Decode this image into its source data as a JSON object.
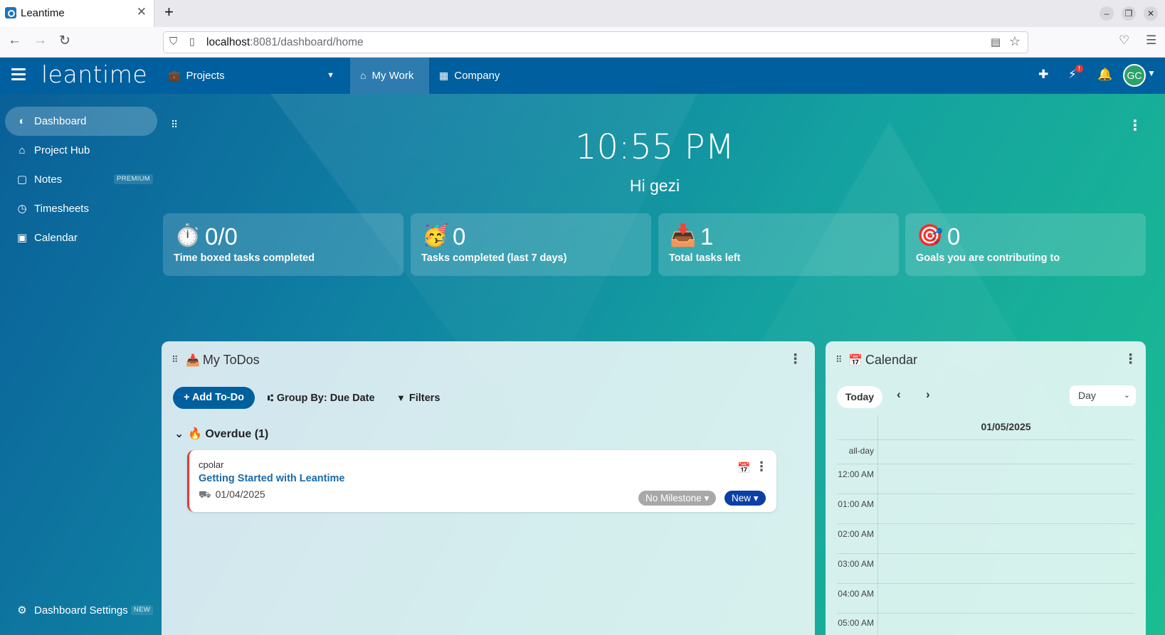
{
  "browser": {
    "tab_title": "Leantime",
    "url_host": "localhost",
    "url_rest": ":8081/dashboard/home"
  },
  "header": {
    "logo": "leantime",
    "projects_label": "Projects",
    "mywork_label": "My Work",
    "company_label": "Company",
    "notification_badge": "!",
    "avatar_initials": "GC"
  },
  "sidebar": {
    "items": [
      {
        "label": "Dashboard",
        "icon": "dashboard-icon"
      },
      {
        "label": "Project Hub",
        "icon": "house-icon"
      },
      {
        "label": "Notes",
        "icon": "note-icon",
        "tag": "PREMIUM"
      },
      {
        "label": "Timesheets",
        "icon": "clock-icon"
      },
      {
        "label": "Calendar",
        "icon": "calendar-icon"
      }
    ],
    "settings": {
      "label": "Dashboard Settings",
      "tag": "NEW"
    }
  },
  "welcome": {
    "time": "10:55 PM",
    "greeting": "Hi gezi"
  },
  "stats": [
    {
      "emoji": "⏱️",
      "value": "0/0",
      "caption": "Time boxed tasks completed"
    },
    {
      "emoji": "🥳",
      "value": "0",
      "caption": "Tasks completed (last 7 days)"
    },
    {
      "emoji": "📥",
      "value": "1",
      "caption": "Total tasks left"
    },
    {
      "emoji": "🎯",
      "value": "0",
      "caption": "Goals you are contributing to"
    }
  ],
  "todos": {
    "title": "My ToDos",
    "title_emoji": "📥",
    "add_label": "+ Add To-Do",
    "group_label": "Group By: Due Date",
    "filters_label": "Filters",
    "group_header": "Overdue (1)",
    "group_emoji": "🔥",
    "items": [
      {
        "project": "cpolar",
        "title": "Getting Started with Leantime",
        "due": "01/04/2025",
        "milestone": "No Milestone",
        "status": "New"
      }
    ]
  },
  "calendar": {
    "title": "Calendar",
    "title_emoji": "📅",
    "today_label": "Today",
    "view": "Day",
    "date": "01/05/2025",
    "allday_label": "all-day",
    "times": [
      "12:00 AM",
      "01:00 AM",
      "02:00 AM",
      "03:00 AM",
      "04:00 AM",
      "05:00 AM"
    ]
  },
  "colors": {
    "header_bg": "#005f9e",
    "accent_blue": "#005f9e",
    "status_new": "#0b3fa6",
    "overdue_red": "#e53935"
  }
}
